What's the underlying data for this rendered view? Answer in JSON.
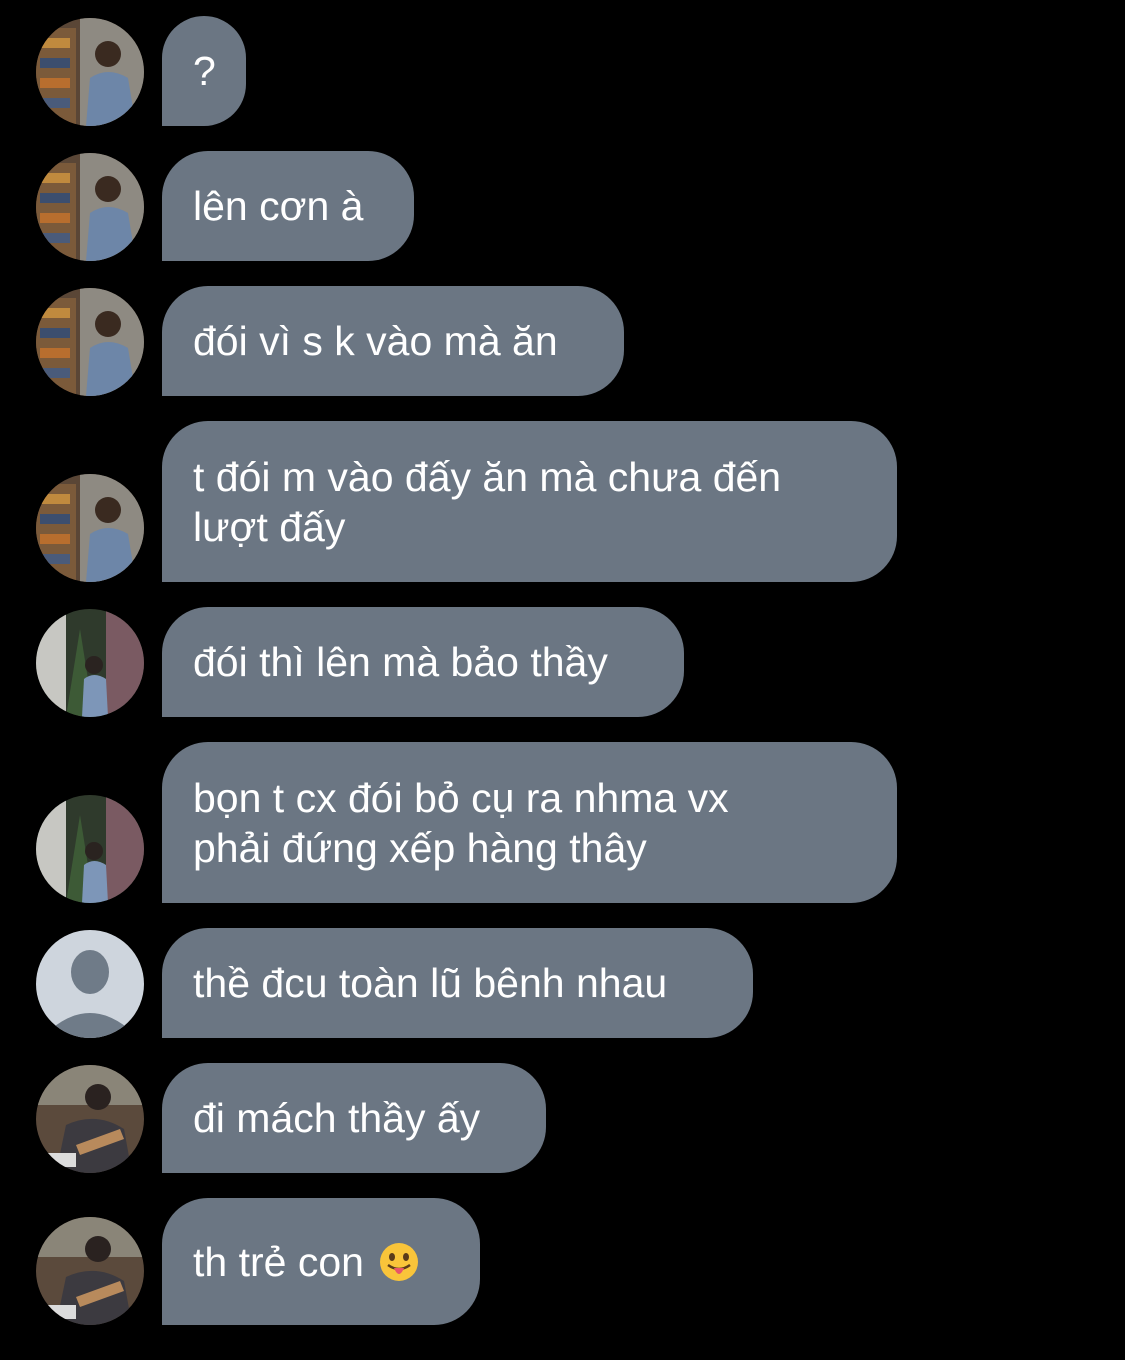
{
  "messages": [
    {
      "avatar": "avatar-user-a",
      "text": "?"
    },
    {
      "avatar": "avatar-user-a",
      "text": "lên cơn à"
    },
    {
      "avatar": "avatar-user-a",
      "text": "đói vì s k vào mà ăn"
    },
    {
      "avatar": "avatar-user-a",
      "text": "t đói m vào đấy ăn mà chưa đến\nlượt đấy"
    },
    {
      "avatar": "avatar-user-b",
      "text": "đói thì lên mà bảo thầy"
    },
    {
      "avatar": "avatar-user-b",
      "text": "bọn t cx đói bỏ cụ ra nhma vx\nphải đứng xếp hàng thây"
    },
    {
      "avatar": "default-avatar-icon",
      "text": "thề đcu toàn lũ bênh nhau"
    },
    {
      "avatar": "avatar-user-c",
      "text": "đi mách thầy ấy"
    },
    {
      "avatar": "avatar-user-c",
      "text": "th trẻ con",
      "emoji": "tongue-out-emoji"
    }
  ],
  "colors": {
    "background": "#000000",
    "bubble": "#6b7683",
    "text": "#ffffff"
  }
}
